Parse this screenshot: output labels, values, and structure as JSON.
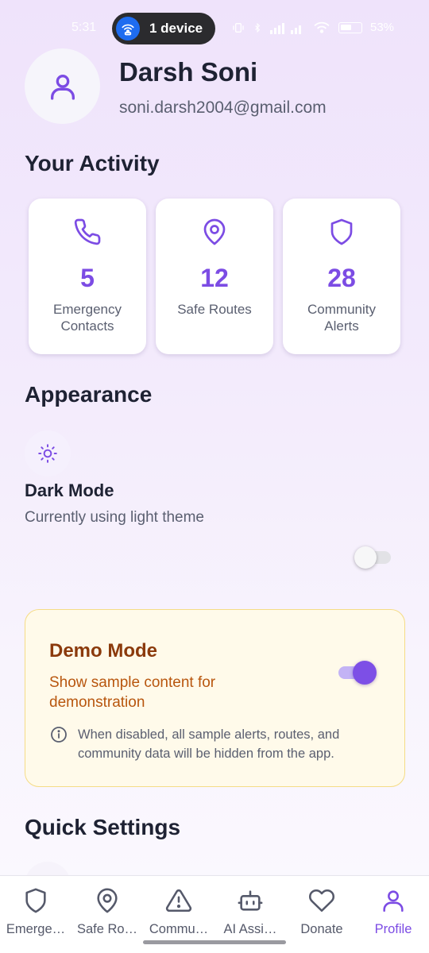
{
  "status_bar": {
    "time": "5:31",
    "hotspot_label": "1 device",
    "right_text": "53%",
    "accent": "#1e6cf0"
  },
  "profile": {
    "name": "Darsh Soni",
    "email": "soni.darsh2004@gmail.com",
    "avatar_icon": "user-icon"
  },
  "activity": {
    "title": "Your Activity",
    "cards": [
      {
        "icon": "phone-icon",
        "value": "5",
        "label": "Emergency Contacts"
      },
      {
        "icon": "map-pin-icon",
        "value": "12",
        "label": "Safe Routes"
      },
      {
        "icon": "shield-icon",
        "value": "28",
        "label": "Community Alerts"
      }
    ]
  },
  "appearance": {
    "title": "Appearance",
    "dark_mode": {
      "icon": "sun-icon",
      "title": "Dark Mode",
      "subtitle": "Currently using light theme",
      "enabled": false
    }
  },
  "demo": {
    "title": "Demo Mode",
    "subtitle": "Show sample content for demonstration",
    "enabled": true,
    "info": "When disabled, all sample alerts, routes, and community data will be hidden from the app."
  },
  "quick_settings": {
    "title": "Quick Settings"
  },
  "nav": {
    "items": [
      {
        "icon": "shield-icon",
        "label": "Emerge…",
        "active": false
      },
      {
        "icon": "map-pin-icon",
        "label": "Safe Ro…",
        "active": false
      },
      {
        "icon": "alert-triangle-icon",
        "label": "Commu…",
        "active": false
      },
      {
        "icon": "bot-icon",
        "label": "AI Assi…",
        "active": false
      },
      {
        "icon": "heart-icon",
        "label": "Donate",
        "active": false
      },
      {
        "icon": "user-icon",
        "label": "Profile",
        "active": true
      }
    ]
  },
  "colors": {
    "accent": "#7c4ce4",
    "demo_title": "#8b3a0c",
    "demo_text": "#b8560e"
  }
}
